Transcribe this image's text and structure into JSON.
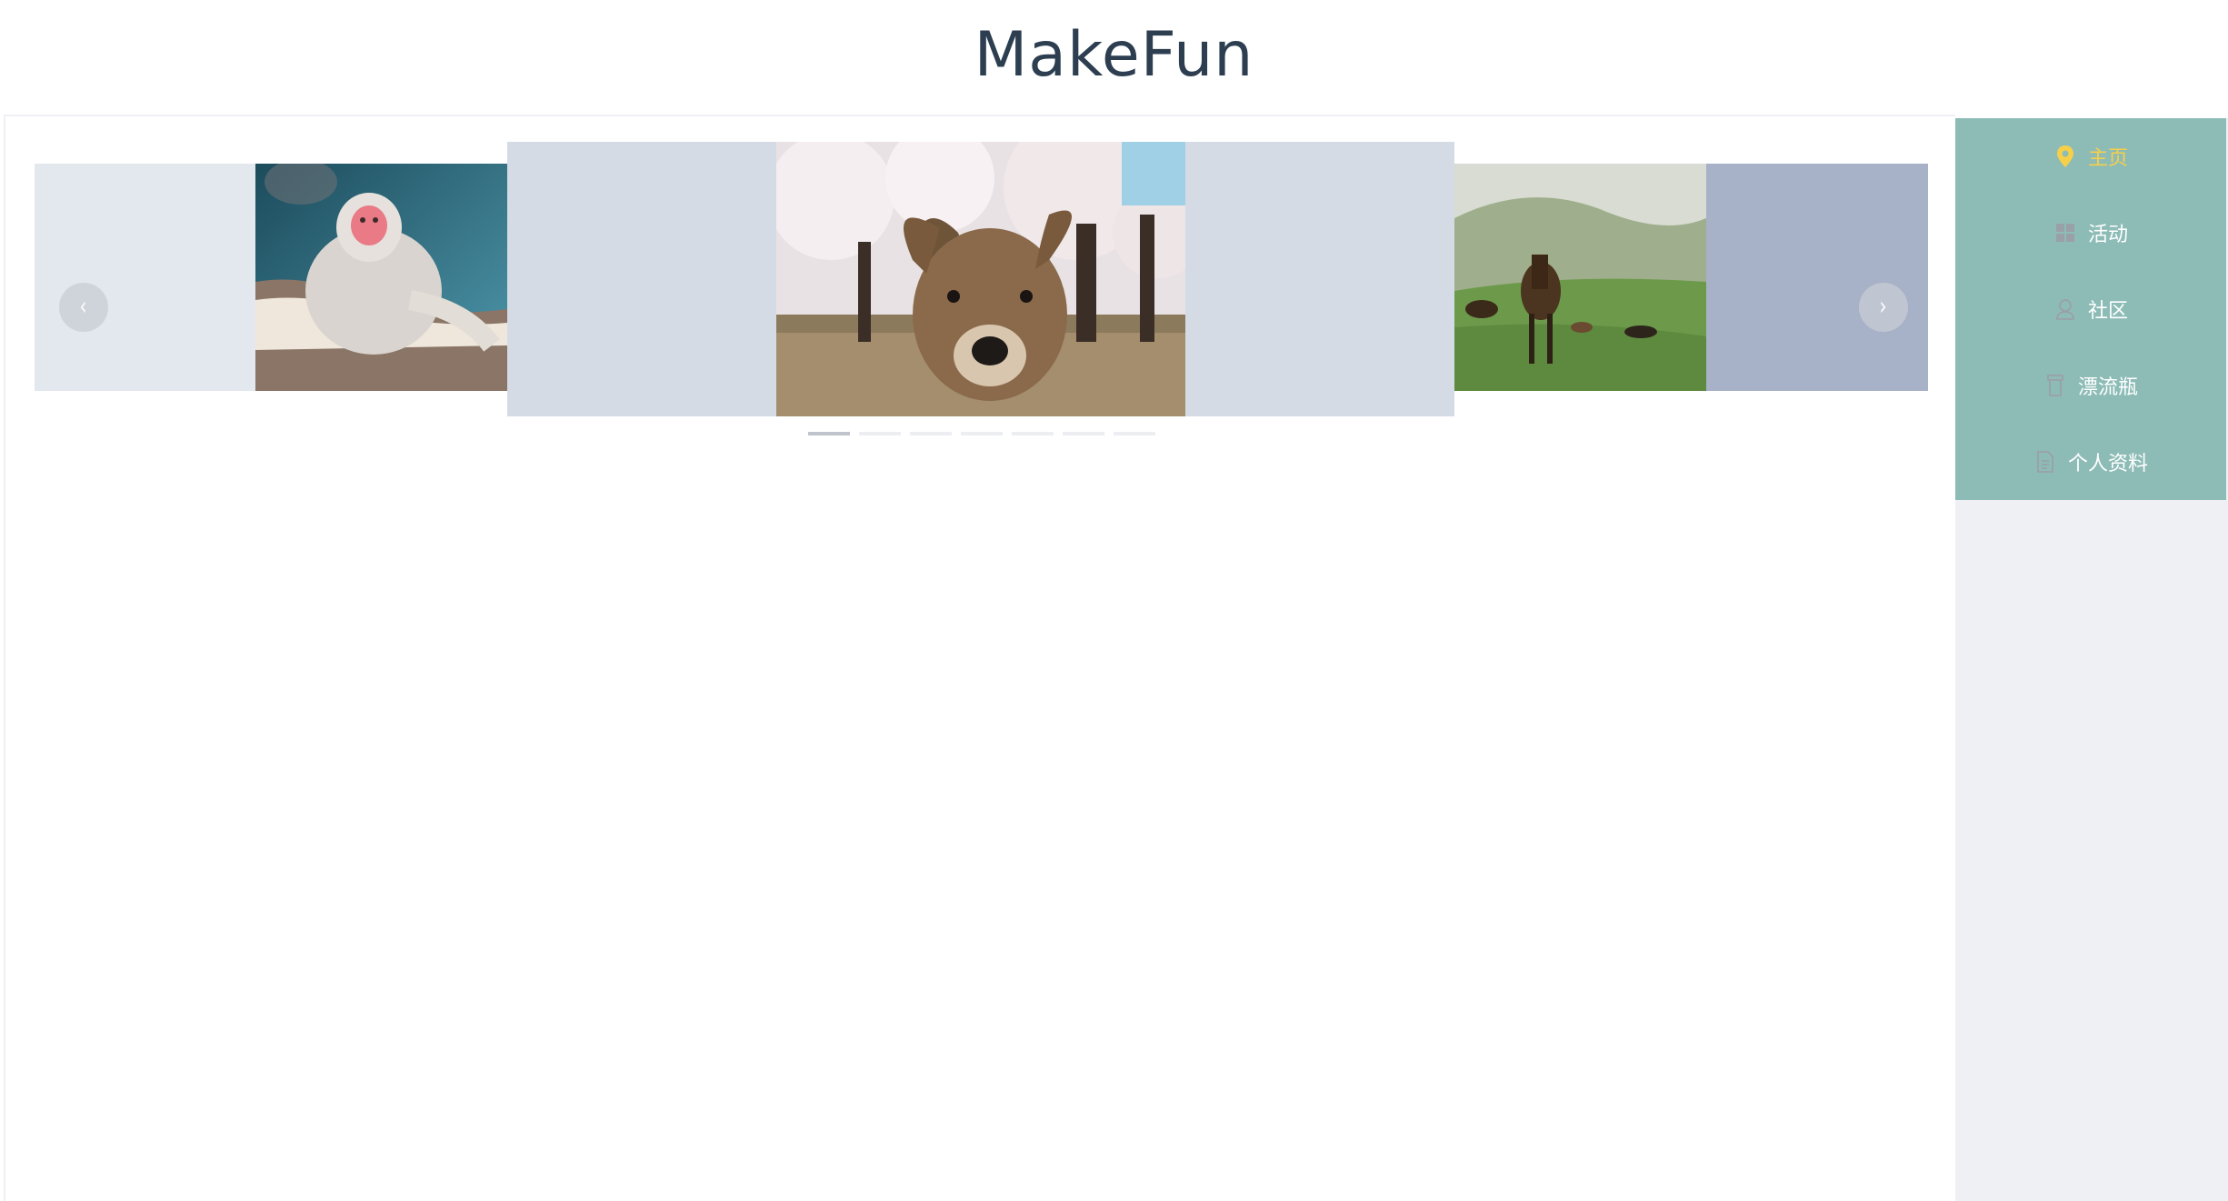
{
  "header": {
    "title": "MakeFun"
  },
  "carousel": {
    "prev_label": "‹",
    "next_label": "›",
    "slides": [
      {
        "image": "snow monkey bathing in hot spring"
      },
      {
        "image": "deer under cherry blossom trees"
      },
      {
        "image": "horses grazing on green hillside"
      }
    ],
    "indicator_count": 7,
    "active_index": 0
  },
  "sidebar": {
    "items": [
      {
        "label": "主页",
        "icon": "location-pin-icon",
        "active": true
      },
      {
        "label": "活动",
        "icon": "grid-icon",
        "active": false
      },
      {
        "label": "社区",
        "icon": "user-icon",
        "active": false
      },
      {
        "label": "漂流瓶",
        "icon": "bottle-icon",
        "active": false
      },
      {
        "label": "个人资料",
        "icon": "document-icon",
        "active": false
      }
    ]
  },
  "colors": {
    "title": "#2c3e50",
    "sidebar_nav_bg": "#8dbcb7",
    "active_nav": "#f6cf4b",
    "sidebar_bg": "#eef0f4"
  }
}
